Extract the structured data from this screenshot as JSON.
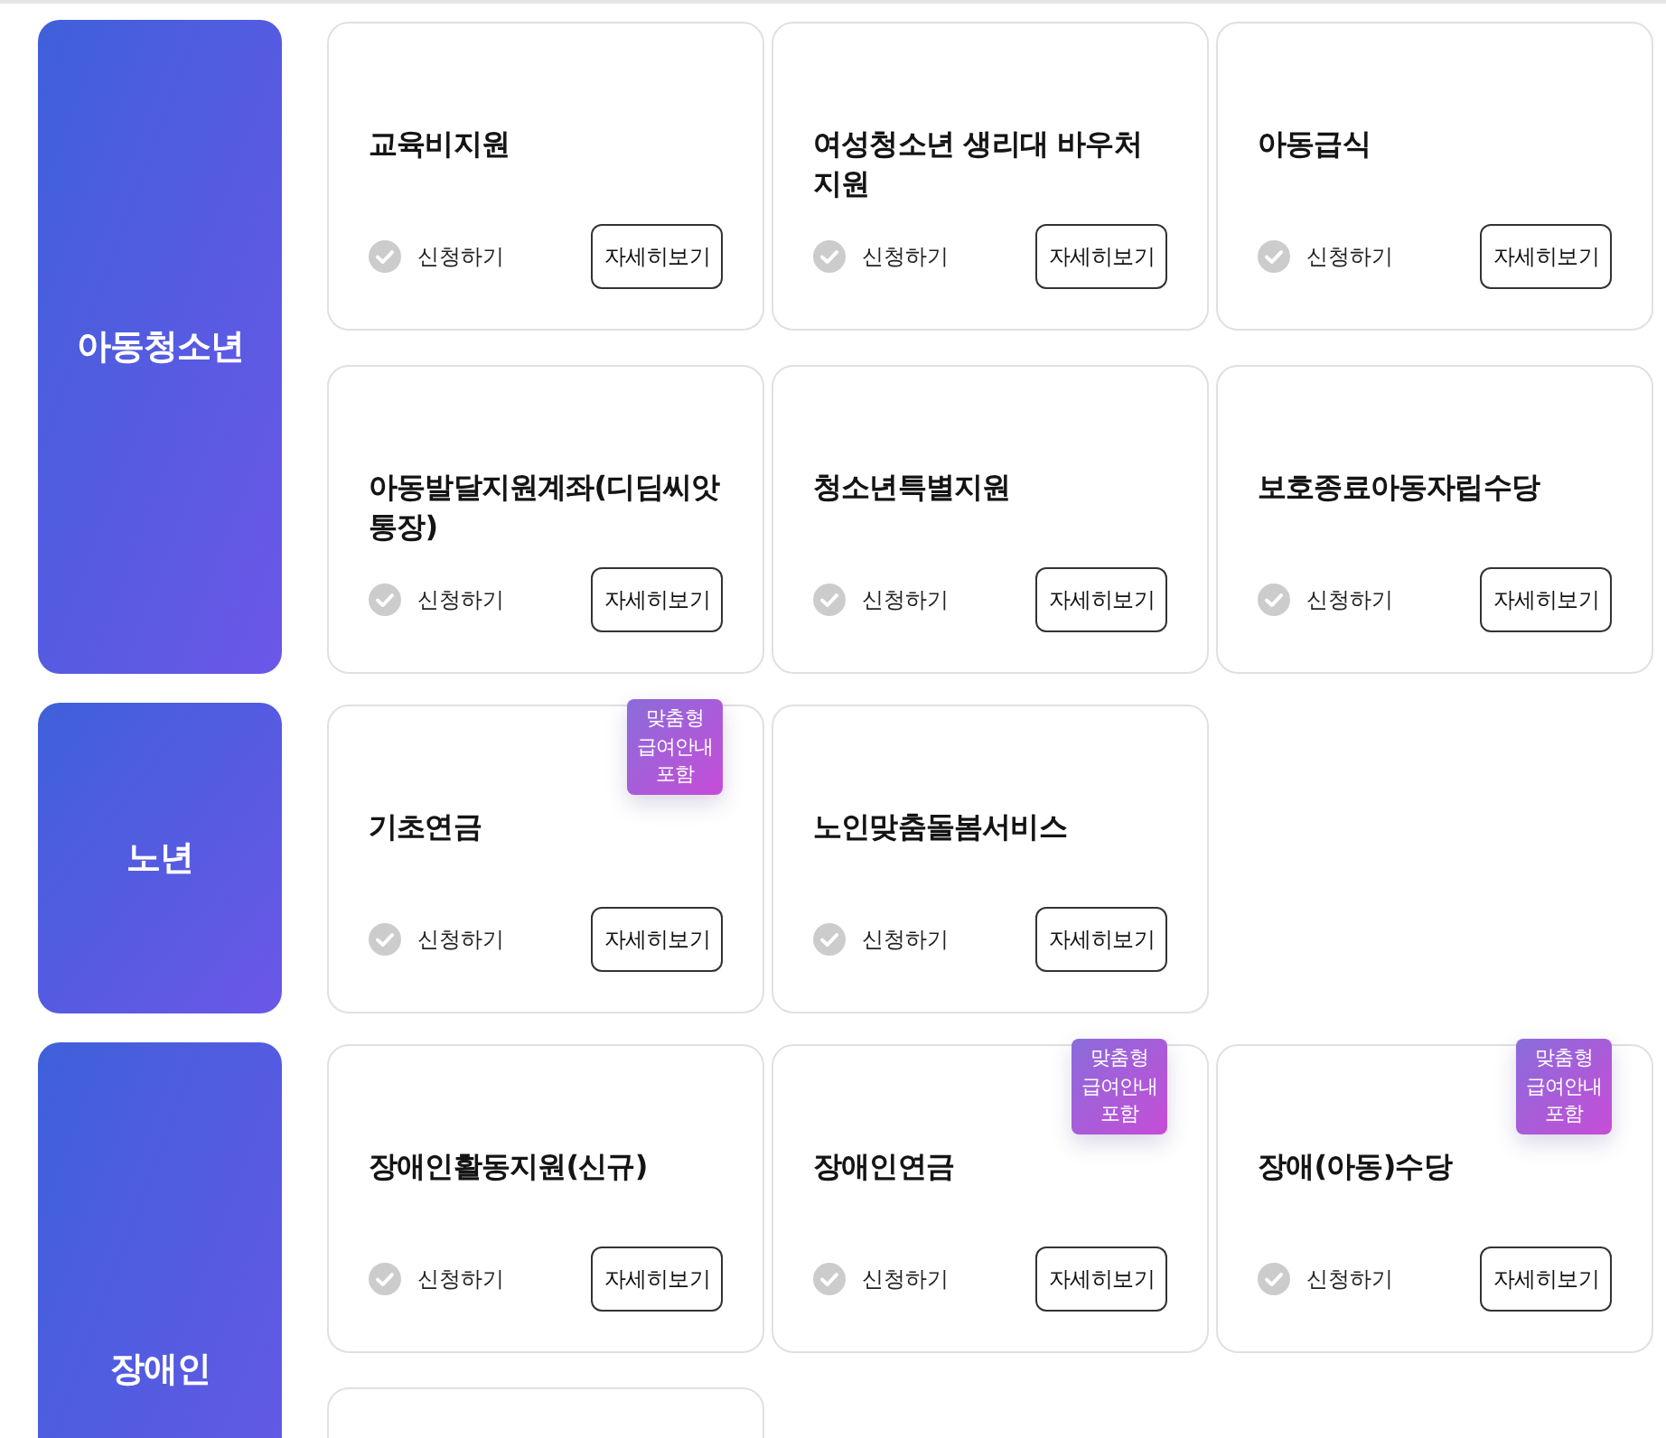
{
  "sections": [
    {
      "category": "아동청소년",
      "cards": [
        {
          "kind": "full",
          "title": "교육비지원",
          "apply_label": "신청하기",
          "checked": false,
          "details_button": "자세히보기"
        },
        {
          "kind": "full",
          "title": "여성청소년 생리대 바우처 지원",
          "apply_label": "신청하기",
          "checked": false,
          "details_button": "자세히보기"
        },
        {
          "kind": "full",
          "title": "아동급식",
          "apply_label": "신청하기",
          "checked": false,
          "details_button": "자세히보기"
        },
        {
          "kind": "full",
          "title": "아동발달지원계좌(디딤씨앗 통장)",
          "apply_label": "신청하기",
          "checked": false,
          "details_button": "자세히보기"
        },
        {
          "kind": "full",
          "title": "청소년특별지원",
          "apply_label": "신청하기",
          "checked": false,
          "details_button": "자세히보기"
        },
        {
          "kind": "full",
          "title": "보호종료아동자립수당",
          "apply_label": "신청하기",
          "checked": false,
          "details_button": "자세히보기"
        }
      ]
    },
    {
      "category": "노년",
      "cards": [
        {
          "kind": "full",
          "tag": "맞춤형 급여안내 포함",
          "title": "기초연금",
          "apply_label": "신청하기",
          "checked": false,
          "details_button": "자세히보기"
        },
        {
          "kind": "full",
          "title": "노인맞춤돌봄서비스",
          "apply_label": "신청하기",
          "checked": false,
          "details_button": "자세히보기"
        }
      ]
    },
    {
      "category": "장애인",
      "cards": [
        {
          "kind": "full",
          "title": "장애인활동지원(신규)",
          "apply_label": "신청하기",
          "checked": false,
          "details_button": "자세히보기"
        },
        {
          "kind": "full",
          "tag": "맞춤형 급여안내 포함",
          "title": "장애인연금",
          "apply_label": "신청하기",
          "checked": false,
          "details_button": "자세히보기"
        },
        {
          "kind": "full",
          "tag": "맞춤형 급여안내 포함",
          "title": "장애(아동)수당",
          "apply_label": "신청하기",
          "checked": false,
          "details_button": "자세히보기"
        },
        {
          "kind": "cut"
        }
      ]
    }
  ]
}
